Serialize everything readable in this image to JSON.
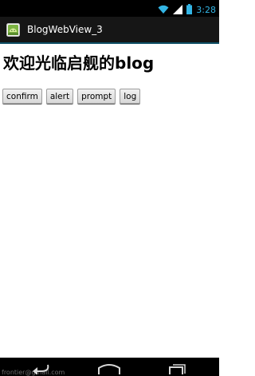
{
  "status_bar": {
    "time": "3:28",
    "icons": [
      "wifi-icon",
      "signal-icon",
      "battery-icon"
    ]
  },
  "action_bar": {
    "title": "BlogWebView_3",
    "icon": "android-app-icon"
  },
  "page": {
    "heading": "欢迎光临启舰的blog",
    "buttons": [
      {
        "label": "confirm"
      },
      {
        "label": "alert"
      },
      {
        "label": "prompt"
      },
      {
        "label": "log"
      }
    ]
  },
  "nav_bar": {
    "icons": [
      "back-icon",
      "home-icon",
      "recent-apps-icon"
    ],
    "overlay_text": "frontier@gmail.com"
  },
  "colors": {
    "status_accent": "#33b5e5",
    "action_bar_bg": "#161616",
    "action_bar_divider": "#0f5066"
  }
}
